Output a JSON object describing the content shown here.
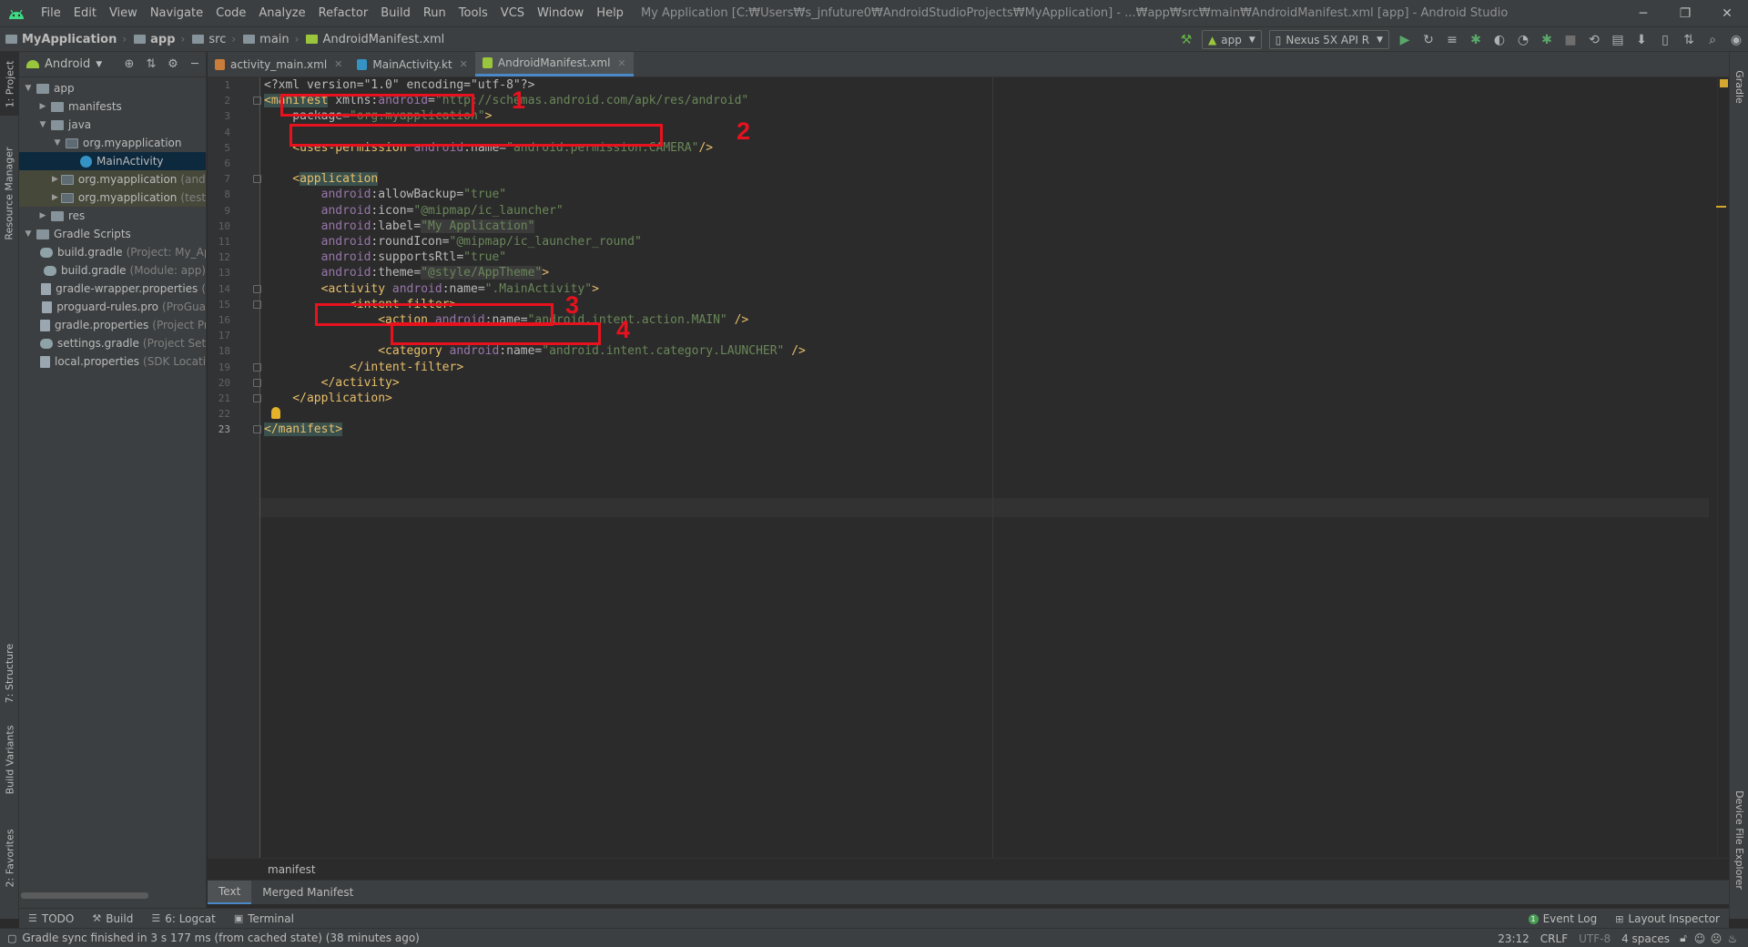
{
  "window": {
    "title": "My Application [C:₩Users₩s_jnfuture0₩AndroidStudioProjects₩MyApplication] - ...₩app₩src₩main₩AndroidManifest.xml [app] - Android Studio",
    "controls": {
      "minimize": "─",
      "maximize": "❐",
      "close": "✕"
    }
  },
  "menu": [
    "File",
    "Edit",
    "View",
    "Navigate",
    "Code",
    "Analyze",
    "Refactor",
    "Build",
    "Run",
    "Tools",
    "VCS",
    "Window",
    "Help"
  ],
  "breadcrumbs": [
    "MyApplication",
    "app",
    "src",
    "main",
    "AndroidManifest.xml"
  ],
  "toolbar": {
    "run_config": "app",
    "device": "Nexus 5X API R"
  },
  "left_tabs": [
    "1: Project",
    "Resource Manager",
    "7: Structure",
    "Build Variants",
    "2: Favorites"
  ],
  "right_tabs": [
    "Gradle",
    "Device File Explorer"
  ],
  "project_panel": {
    "view": "Android",
    "tree": [
      {
        "label": "app",
        "hint": "",
        "depth": 0,
        "state": "open",
        "icon": "folder-icon"
      },
      {
        "label": "manifests",
        "hint": "",
        "depth": 1,
        "state": "closed",
        "icon": "folder-icon"
      },
      {
        "label": "java",
        "hint": "",
        "depth": 1,
        "state": "open",
        "icon": "folder-icon"
      },
      {
        "label": "org.myapplication",
        "hint": "",
        "depth": 2,
        "state": "open",
        "icon": "package-icon"
      },
      {
        "label": "MainActivity",
        "hint": "",
        "depth": 3,
        "state": "leaf",
        "icon": "kotlin-class-icon",
        "selected": true
      },
      {
        "label": "org.myapplication",
        "hint": "(andr",
        "depth": 2,
        "state": "closed",
        "icon": "package-icon",
        "tinted": true
      },
      {
        "label": "org.myapplication",
        "hint": "(test)",
        "depth": 2,
        "state": "closed",
        "icon": "package-icon",
        "tinted": true
      },
      {
        "label": "res",
        "hint": "",
        "depth": 1,
        "state": "closed",
        "icon": "folder-icon"
      },
      {
        "label": "Gradle Scripts",
        "hint": "",
        "depth": 0,
        "state": "open",
        "icon": "gradle-folder-icon"
      },
      {
        "label": "build.gradle",
        "hint": "(Project: My_Ap",
        "depth": 1,
        "state": "leaf",
        "icon": "gradle-icon"
      },
      {
        "label": "build.gradle",
        "hint": "(Module: app)",
        "depth": 1,
        "state": "leaf",
        "icon": "gradle-icon"
      },
      {
        "label": "gradle-wrapper.properties",
        "hint": "(",
        "depth": 1,
        "state": "leaf",
        "icon": "properties-icon"
      },
      {
        "label": "proguard-rules.pro",
        "hint": "(ProGua",
        "depth": 1,
        "state": "leaf",
        "icon": "file-icon"
      },
      {
        "label": "gradle.properties",
        "hint": "(Project Pr",
        "depth": 1,
        "state": "leaf",
        "icon": "properties-icon"
      },
      {
        "label": "settings.gradle",
        "hint": "(Project Sett",
        "depth": 1,
        "state": "leaf",
        "icon": "gradle-icon"
      },
      {
        "label": "local.properties",
        "hint": "(SDK Locati",
        "depth": 1,
        "state": "leaf",
        "icon": "properties-icon"
      }
    ]
  },
  "editor_tabs": [
    {
      "label": "activity_main.xml",
      "active": false,
      "icon_color": "#c97d3a"
    },
    {
      "label": "MainActivity.kt",
      "active": false,
      "icon_color": "#3592c4"
    },
    {
      "label": "AndroidManifest.xml",
      "active": true,
      "icon_color": "#9ac63e"
    }
  ],
  "code": {
    "current_line": 23,
    "lines": [
      [
        {
          "t": "<?xml version=\"1.0\" encoding=\"utf-8\"?>",
          "c": "t-attr"
        }
      ],
      [
        {
          "t": "<manifest",
          "c": "t-tag tag-hl"
        },
        {
          "t": " xmlns:",
          "c": "t-attr"
        },
        {
          "t": "android",
          "c": "t-ns"
        },
        {
          "t": "=",
          "c": "t-attr"
        },
        {
          "t": "\"http://schemas.android.com/apk/res/android\"",
          "c": "t-str"
        }
      ],
      [
        {
          "t": "    package",
          "c": "t-attr"
        },
        {
          "t": "=",
          "c": "t-attr"
        },
        {
          "t": "\"org.myapplication\"",
          "c": "t-str"
        },
        {
          "t": ">",
          "c": "t-pun"
        }
      ],
      [],
      [
        {
          "t": "    <uses-permission",
          "c": "t-tag"
        },
        {
          "t": " android",
          "c": "t-ns"
        },
        {
          "t": ":name=",
          "c": "t-attr"
        },
        {
          "t": "\"android.permission.CAMERA\"",
          "c": "t-str"
        },
        {
          "t": "/>",
          "c": "t-pun"
        }
      ],
      [],
      [
        {
          "t": "    <",
          "c": "t-pun"
        },
        {
          "t": "application",
          "c": "t-tag tag-hl"
        }
      ],
      [
        {
          "t": "        android",
          "c": "t-ns"
        },
        {
          "t": ":allowBackup=",
          "c": "t-attr"
        },
        {
          "t": "\"true\"",
          "c": "t-str"
        }
      ],
      [
        {
          "t": "        android",
          "c": "t-ns"
        },
        {
          "t": ":icon=",
          "c": "t-attr"
        },
        {
          "t": "\"@mipmap/ic_launcher\"",
          "c": "t-str"
        }
      ],
      [
        {
          "t": "        android",
          "c": "t-ns"
        },
        {
          "t": ":label=",
          "c": "t-attr"
        },
        {
          "t": "\"My Application\"",
          "c": "t-str str-hl"
        }
      ],
      [
        {
          "t": "        android",
          "c": "t-ns"
        },
        {
          "t": ":roundIcon=",
          "c": "t-attr"
        },
        {
          "t": "\"@mipmap/ic_launcher_round\"",
          "c": "t-str"
        }
      ],
      [
        {
          "t": "        android",
          "c": "t-ns"
        },
        {
          "t": ":supportsRtl=",
          "c": "t-attr"
        },
        {
          "t": "\"true\"",
          "c": "t-str"
        }
      ],
      [
        {
          "t": "        android",
          "c": "t-ns"
        },
        {
          "t": ":theme=",
          "c": "t-attr"
        },
        {
          "t": "\"@style/AppTheme\"",
          "c": "t-str str-hl"
        },
        {
          "t": ">",
          "c": "t-pun"
        }
      ],
      [
        {
          "t": "        <activity",
          "c": "t-tag"
        },
        {
          "t": " android",
          "c": "t-ns"
        },
        {
          "t": ":name=",
          "c": "t-attr"
        },
        {
          "t": "\".MainActivity\"",
          "c": "t-str"
        },
        {
          "t": ">",
          "c": "t-pun"
        }
      ],
      [
        {
          "t": "            <intent-filter>",
          "c": "t-tag"
        }
      ],
      [
        {
          "t": "                <action",
          "c": "t-tag"
        },
        {
          "t": " android",
          "c": "t-ns"
        },
        {
          "t": ":name=",
          "c": "t-attr"
        },
        {
          "t": "\"android.intent.action.MAIN\"",
          "c": "t-str"
        },
        {
          "t": " />",
          "c": "t-pun"
        }
      ],
      [],
      [
        {
          "t": "                <category",
          "c": "t-tag"
        },
        {
          "t": " android",
          "c": "t-ns"
        },
        {
          "t": ":name=",
          "c": "t-attr"
        },
        {
          "t": "\"android.intent.category.LAUNCHER\"",
          "c": "t-str"
        },
        {
          "t": " />",
          "c": "t-pun"
        }
      ],
      [
        {
          "t": "            </intent-filter>",
          "c": "t-tag"
        }
      ],
      [
        {
          "t": "        </activity>",
          "c": "t-tag"
        }
      ],
      [
        {
          "t": "    </application>",
          "c": "t-tag"
        }
      ],
      [],
      [
        {
          "t": "</manifest>",
          "c": "t-tag tag-hl"
        }
      ]
    ]
  },
  "annotations": [
    "1",
    "2",
    "3",
    "4"
  ],
  "editor_breadcrumb": "manifest",
  "design_tabs": [
    {
      "label": "Text",
      "active": true
    },
    {
      "label": "Merged Manifest",
      "active": false
    }
  ],
  "tool_windows": [
    {
      "label": "TODO",
      "icon": "☰"
    },
    {
      "label": "Build",
      "icon": "⚒"
    },
    {
      "label": "6: Logcat",
      "icon": "☰"
    },
    {
      "label": "Terminal",
      "icon": "▣"
    }
  ],
  "tool_windows_right": [
    {
      "label": "Event Log",
      "badge": "1"
    },
    {
      "label": "Layout Inspector",
      "badge": ""
    }
  ],
  "status": {
    "message": "Gradle sync finished in 3 s 177 ms (from cached state) (38 minutes ago)",
    "position": "23:12",
    "line_sep": "CRLF",
    "encoding": "UTF-8",
    "indent": "4 spaces"
  },
  "colors": {
    "accent": "#4a88c7",
    "annotation": "#e8121e",
    "android_green": "#9ac63e",
    "run_green": "#499c54"
  }
}
